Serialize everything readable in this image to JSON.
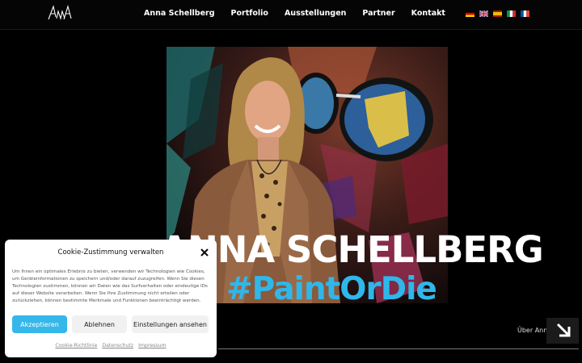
{
  "header": {
    "logo_text": "AnnA",
    "nav": [
      "Anna Schellberg",
      "Portfolio",
      "Ausstellungen",
      "Partner",
      "Kontakt"
    ],
    "languages": [
      {
        "name": "de-flag-icon",
        "colors": [
          "#000000",
          "#dd0000",
          "#ffce00"
        ]
      },
      {
        "name": "gb-flag-icon",
        "colors": [
          "#012169",
          "#ffffff",
          "#c8102e"
        ]
      },
      {
        "name": "es-flag-icon",
        "colors": [
          "#aa151b",
          "#f1bf00",
          "#aa151b"
        ]
      },
      {
        "name": "it-flag-icon",
        "colors": [
          "#009246",
          "#ffffff",
          "#ce2b37"
        ]
      },
      {
        "name": "fr-flag-icon",
        "colors": [
          "#0055a4",
          "#ffffff",
          "#ef4135"
        ]
      }
    ]
  },
  "hero": {
    "name": "ANNA SCHELLBERG",
    "hashtag": "#PaintOrDie",
    "about_link": "Über Anna",
    "accent": "#2fb7ea"
  },
  "cookie": {
    "title": "Cookie-Zustimmung verwalten",
    "text": "Um Ihnen ein optimales Erlebnis zu bieten, verwenden wir Technologien wie Cookies, um Geräteinformationen zu speichern und/oder darauf zuzugreifen. Wenn Sie diesen Technologien zustimmen, können wir Daten wie das Surfverhalten oder eindeutige IDs auf dieser Website verarbeiten. Wenn Sie Ihre Zustimmung nicht erteilen oder zurückziehen, können bestimmte Merkmale und Funktionen beeinträchtigt werden.",
    "accept": "Akzeptieren",
    "deny": "Ablehnen",
    "settings": "Einstellungen ansehen",
    "links": [
      "Cookie-Richtlinie",
      "Datenschutz",
      "Impressum"
    ]
  }
}
